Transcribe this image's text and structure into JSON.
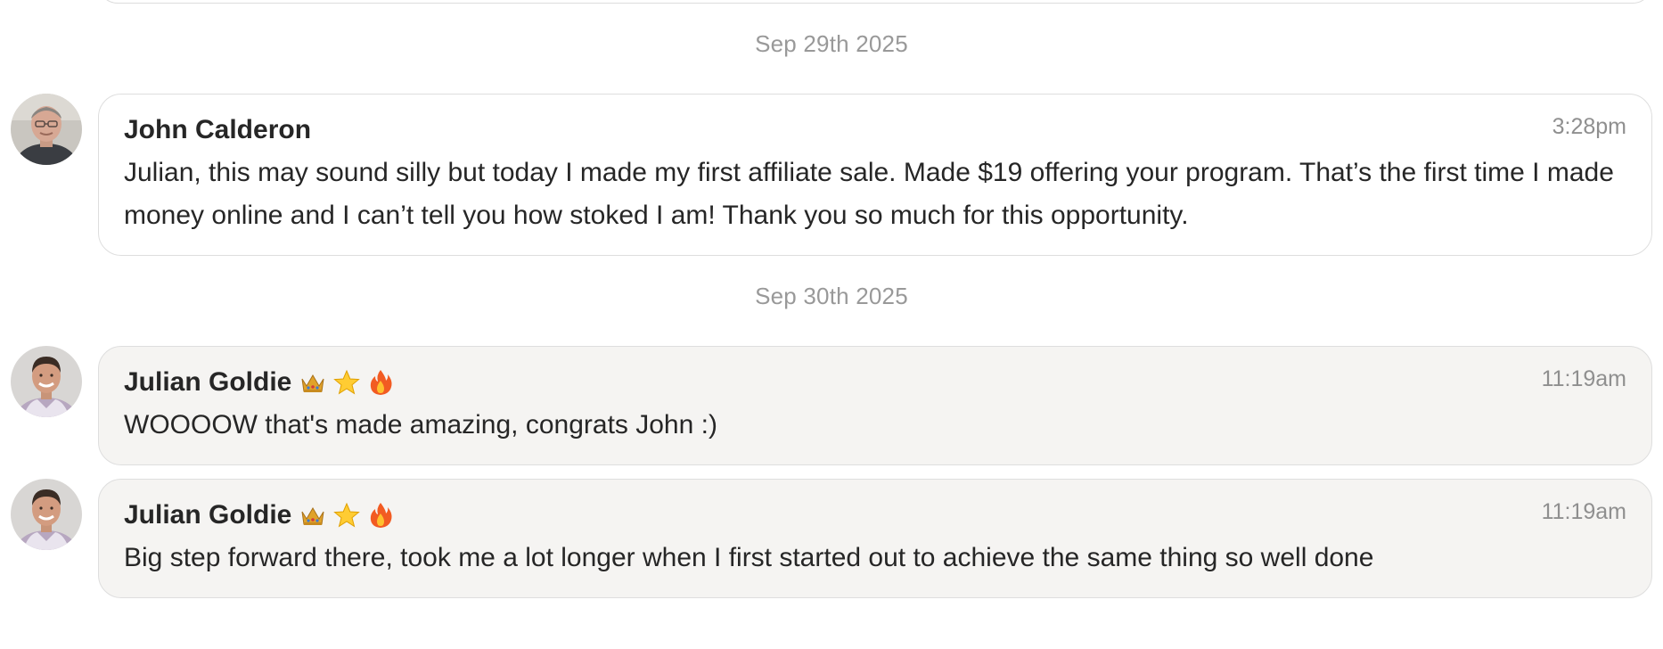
{
  "feed": {
    "date_1": "Sep 29th 2025",
    "date_2": "Sep 30th 2025",
    "messages": [
      {
        "author": "John Calderon",
        "time": "3:28pm",
        "text": "Julian, this may sound silly but today I made my first affiliate sale. Made $19 offering your program. That’s the first time I made money online and I can’t tell you how stoked I am! Thank you so much for this opportunity.",
        "badges": []
      },
      {
        "author": "Julian Goldie",
        "time": "11:19am",
        "text": "WOOOOW that's made amazing, congrats John :)",
        "badges": [
          "crown-icon",
          "star-icon",
          "fire-icon"
        ]
      },
      {
        "author": "Julian Goldie",
        "time": "11:19am",
        "text": "Big step forward there, took me a lot longer when I first started out to achieve the same thing so well done",
        "badges": [
          "crown-icon",
          "star-icon",
          "fire-icon"
        ]
      }
    ]
  },
  "colors": {
    "bubble_white": "#ffffff",
    "bubble_grey": "#f5f4f2",
    "border": "#dedede",
    "muted_text": "#999999",
    "body_text": "#262626"
  }
}
